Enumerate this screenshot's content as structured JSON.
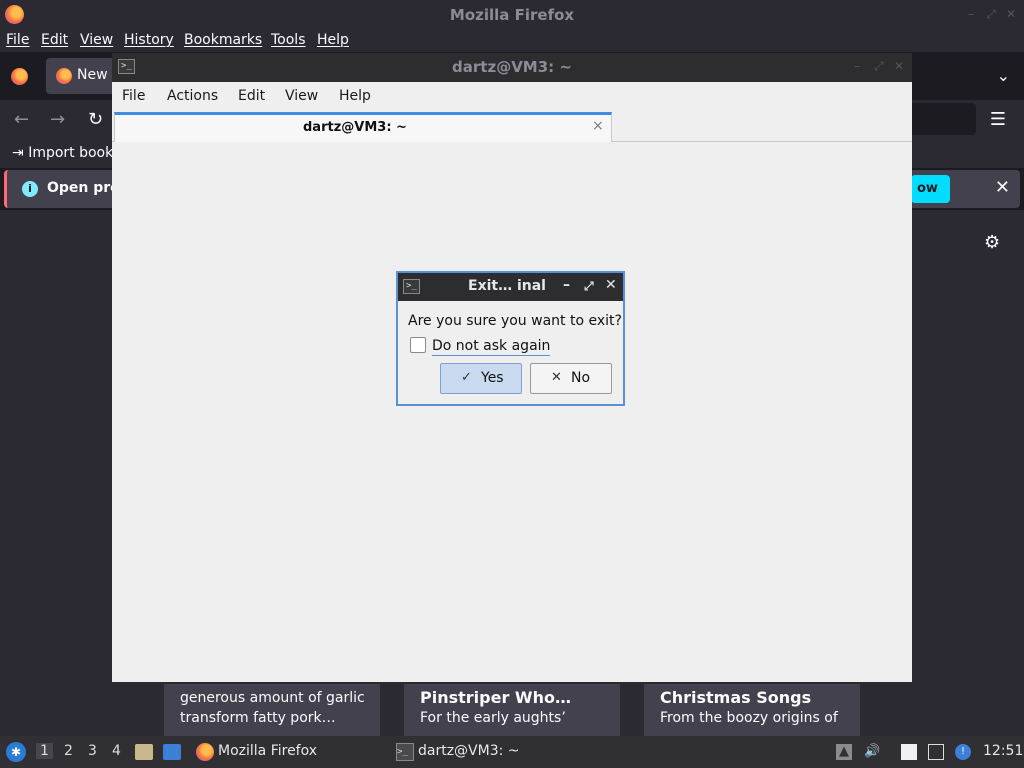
{
  "firefox": {
    "title": "Mozilla Firefox",
    "menu": [
      "File",
      "Edit",
      "View",
      "History",
      "Bookmarks",
      "Tools",
      "Help"
    ],
    "tab_label": "New",
    "bookmarks_item": "Import book",
    "notification_text": "Open pre",
    "notification_button": "ow",
    "cards": [
      {
        "title": "",
        "text1": "generous amount of garlic",
        "text2": "transform fatty pork…"
      },
      {
        "title": "Pinstriper Who…",
        "text1": "For the early aughts’",
        "text2": ""
      },
      {
        "title": "Christmas Songs",
        "text1": "From the boozy origins of",
        "text2": ""
      }
    ]
  },
  "terminal": {
    "title": "dartz@VM3: ~",
    "menu": [
      "File",
      "Actions",
      "Edit",
      "View",
      "Help"
    ],
    "tab_label": "dartz@VM3: ~",
    "tab_close": "×"
  },
  "dialog": {
    "title": "Exit… inal",
    "message": "Are you sure you want to exit?",
    "checkbox_label": "Do not ask again",
    "checkbox_checked": false,
    "yes_label": "Yes",
    "no_label": "No"
  },
  "taskbar": {
    "workspaces": [
      "1",
      "2",
      "3",
      "4"
    ],
    "active_workspace": "1",
    "tasks": [
      {
        "label": "Mozilla Firefox",
        "icon": "firefox-icon"
      },
      {
        "label": "dartz@VM3: ~",
        "icon": "terminal-icon"
      }
    ],
    "clock": "12:51"
  },
  "colors": {
    "ff_dark": "#1c1b22",
    "ff_toolbar": "#2b2a33",
    "accent_cyan": "#00ddff",
    "dialog_border": "#5b8fd6"
  }
}
